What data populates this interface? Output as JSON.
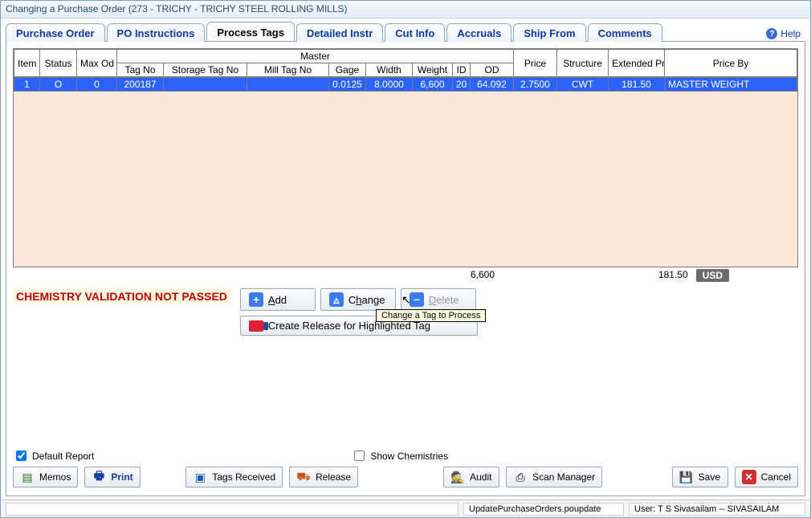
{
  "title": "Changing a Purchase Order  (273 - TRICHY - TRICHY STEEL ROLLING MILLS)",
  "tabs": {
    "purchase_order": "Purchase Order",
    "po_instructions": "PO Instructions",
    "process_tags": "Process Tags",
    "detailed_instr": "Detailed Instr",
    "cut_info": "Cut Info",
    "accruals": "Accruals",
    "ship_from": "Ship From",
    "comments": "Comments"
  },
  "help_label": "Help",
  "grid": {
    "headers": {
      "item": "Item",
      "status": "Status",
      "max_od": "Max Od",
      "master": "Master",
      "tag_no": "Tag No",
      "storage_tag_no": "Storage Tag No",
      "mill_tag_no": "Mill Tag No",
      "gage": "Gage",
      "width": "Width",
      "weight": "Weight",
      "id": "ID",
      "od": "OD",
      "price": "Price",
      "structure": "Structure",
      "ext_price": "Extended Price",
      "price_by": "Price By"
    },
    "rows": [
      {
        "item": "1",
        "status": "O",
        "max_od": "0",
        "tag_no": "200187",
        "storage_tag_no": "",
        "mill_tag_no": "",
        "gage": "0.0125",
        "width": "8.0000",
        "weight": "6,600",
        "id": "20",
        "od": "64.092",
        "price": "2.7500",
        "structure": "CWT",
        "ext_price": "181.50",
        "price_by": "MASTER WEIGHT"
      }
    ],
    "totals": {
      "weight": "6,600",
      "ext_price": "181.50",
      "currency": "USD"
    }
  },
  "validation_msg": "CHEMISTRY VALIDATION NOT PASSED",
  "buttons": {
    "add": "Add",
    "change": "Change",
    "delete": "Delete",
    "create_release": "Create Release for Highlighted Tag"
  },
  "tooltip_change": "Change a Tag to Process",
  "checkboxes": {
    "default_report": "Default Report",
    "show_chem": "Show Chemistries"
  },
  "footer_buttons": {
    "memos": "Memos",
    "print": "Print",
    "tags_received": "Tags Received",
    "release": "Release",
    "audit": "Audit",
    "scan_manager": "Scan Manager",
    "save": "Save",
    "cancel": "Cancel"
  },
  "status": {
    "left": "",
    "center": "UpdatePurchaseOrders.poupdate",
    "right": "User: T S Sivasailam -- SIVASAILAM"
  },
  "colors": {
    "accent": "#2a63ff"
  }
}
